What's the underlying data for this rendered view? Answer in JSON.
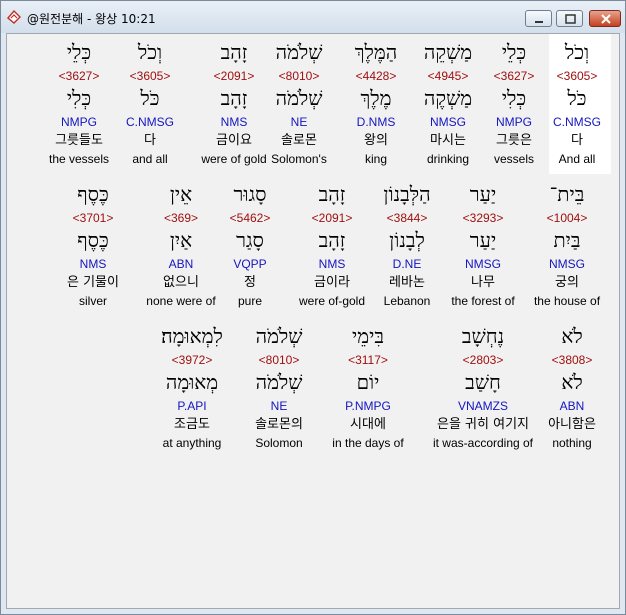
{
  "window": {
    "title": "@원전분해 - 왕상 10:21",
    "icon": "bible-book-icon",
    "controls": [
      "minimize",
      "maximize",
      "close"
    ],
    "colors": {
      "strong": "#a01010",
      "parse": "#1515c0",
      "highlight": "#ffffff"
    }
  },
  "rows": [
    [
      {
        "heb": "וְכֹל",
        "strong": "<3605>",
        "lemma": "כֹּל",
        "parse": "C.NMSG",
        "kor": "다",
        "eng": "And all",
        "selected": true
      },
      {
        "heb": "כְּלֵי",
        "strong": "<3627>",
        "lemma": "כְּלִי",
        "parse": "NMPG",
        "kor": "그릇은",
        "eng": "vessels"
      },
      {
        "heb": "מַשְׁקֵה",
        "strong": "<4945>",
        "lemma": "מַשְׁקֶה",
        "parse": "NMSG",
        "kor": "마시는",
        "eng": "drinking"
      },
      {
        "heb": "הַמֶּלֶךְ",
        "strong": "<4428>",
        "lemma": "מֶלֶךְ",
        "parse": "D.NMS",
        "kor": "왕의",
        "eng": "king"
      },
      {
        "heb": "שְׁלֹמֹה",
        "strong": "<8010>",
        "lemma": "שְׁלֹמֹה",
        "parse": "NE",
        "kor": "솔로몬",
        "eng": "Solomon's"
      },
      {
        "heb": "זָהָב",
        "strong": "<2091>",
        "lemma": "זָהָב",
        "parse": "NMS",
        "kor": "금이요",
        "eng": "were of gold"
      },
      {
        "heb": "וְכֹל",
        "strong": "<3605>",
        "lemma": "כֹּל",
        "parse": "C.NMSG",
        "kor": "다",
        "eng": "and all"
      },
      {
        "heb": "כְּלֵי",
        "strong": "<3627>",
        "lemma": "כְּלִי",
        "parse": "NMPG",
        "kor": "그릇들도",
        "eng": "the vessels"
      }
    ],
    [
      {
        "heb": "בֵּית־",
        "strong": "<1004>",
        "lemma": "בַּיִת",
        "parse": "NMSG",
        "kor": "궁의",
        "eng": "the house of"
      },
      {
        "heb": "יַעַר",
        "strong": "<3293>",
        "lemma": "יַעַר",
        "parse": "NMSG",
        "kor": "나무",
        "eng": "the forest of"
      },
      {
        "heb": "הַלְּבָנוֹן",
        "strong": "<3844>",
        "lemma": "לְבָנוֹן",
        "parse": "D.NE",
        "kor": "레바논",
        "eng": "Lebanon"
      },
      {
        "heb": "זָהָב",
        "strong": "<2091>",
        "lemma": "זָהָב",
        "parse": "NMS",
        "kor": "금이라",
        "eng": "were of-gold"
      },
      {
        "heb": "סָגוּר",
        "strong": "<5462>",
        "lemma": "סָגַר",
        "parse": "VQPP",
        "kor": "정",
        "eng": "pure"
      },
      {
        "heb": "אֵין",
        "strong": "<369>",
        "lemma": "אַיִן",
        "parse": "ABN",
        "kor": "없으니",
        "eng": "none were of"
      },
      {
        "heb": "כֶּסֶף",
        "strong": "<3701>",
        "lemma": "כֶּסֶף",
        "parse": "NMS",
        "kor": "은 기물이",
        "eng": "silver"
      }
    ],
    [
      {
        "heb": "לֹא",
        "strong": "<3808>",
        "lemma": "לֹא",
        "parse": "ABN",
        "kor": "아니함은",
        "eng": "nothing"
      },
      {
        "heb": "נֶחְשָׁב",
        "strong": "<2803>",
        "lemma": "חָשַׁב",
        "parse": "VNAMZS",
        "kor": "은을 귀히 여기지",
        "eng": "it was-according of"
      },
      {
        "heb": "בִּימֵי",
        "strong": "<3117>",
        "lemma": "יוֹם",
        "parse": "P.NMPG",
        "kor": "시대에",
        "eng": "in the days of"
      },
      {
        "heb": "שְׁלֹמֹה",
        "strong": "<8010>",
        "lemma": "שְׁלֹמֹה",
        "parse": "NE",
        "kor": "솔로몬의",
        "eng": "Solomon"
      },
      {
        "heb": "לִמְאוּמָה׃",
        "strong": "<3972>",
        "lemma": "מְאוּמָה",
        "parse": "P.API",
        "kor": "조금도",
        "eng": "at anything"
      }
    ]
  ]
}
